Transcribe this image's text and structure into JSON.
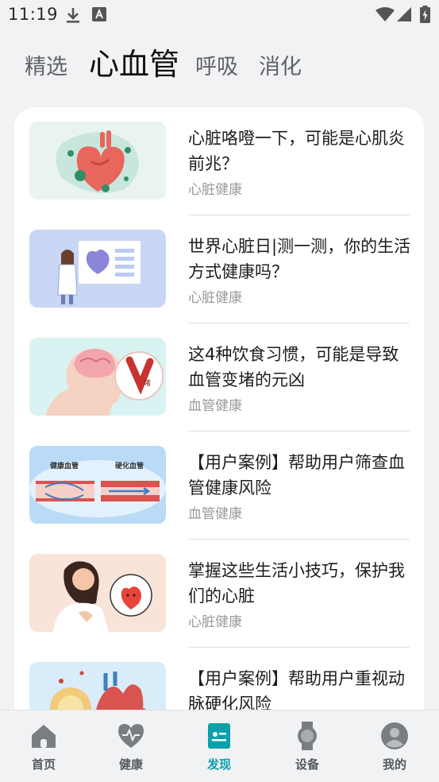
{
  "status_bar": {
    "time": "11:19",
    "icons": [
      "download-icon",
      "keyboard-a-icon",
      "wifi-icon",
      "signal-icon",
      "battery-charging-icon"
    ]
  },
  "tabs": [
    {
      "label": "精选",
      "active": false
    },
    {
      "label": "心血管",
      "active": true
    },
    {
      "label": "呼吸",
      "active": false
    },
    {
      "label": "消化",
      "active": false
    }
  ],
  "articles": [
    {
      "title": "心脏咯噔一下，可能是心肌炎前兆？",
      "tag": "心脏健康",
      "image": "heart-virus-illustration"
    },
    {
      "title": "世界心脏日|测一测，你的生活方式健康吗？",
      "tag": "心脏健康",
      "image": "doctor-heart-screen-illustration"
    },
    {
      "title": "这4种饮食习惯，可能是导致血管变堵的元凶",
      "tag": "血管健康",
      "image": "brain-artery-blockage-illustration",
      "image_text": "堵"
    },
    {
      "title": "【用户案例】帮助用户筛查血管健康风险",
      "tag": "血管健康",
      "image": "vessel-comparison-illustration",
      "image_labels": [
        "健康血管",
        "硬化血管"
      ]
    },
    {
      "title": "掌握这些生活小技巧，保护我们的心脏",
      "tag": "心脏健康",
      "image": "woman-heart-illustration"
    },
    {
      "title": "【用户案例】帮助用户重视动脉硬化风险",
      "tag": "",
      "image": "artery-organs-illustration"
    }
  ],
  "bottom_nav": [
    {
      "label": "首页",
      "icon": "home-icon",
      "active": false
    },
    {
      "label": "健康",
      "icon": "heart-pulse-icon",
      "active": false
    },
    {
      "label": "发现",
      "icon": "discover-card-icon",
      "active": true
    },
    {
      "label": "设备",
      "icon": "watch-icon",
      "active": false
    },
    {
      "label": "我的",
      "icon": "profile-icon",
      "active": false
    }
  ],
  "colors": {
    "accent": "#0aa1ad",
    "background": "#f1f2f4",
    "card": "#ffffff",
    "tag_text": "#9a9a9a"
  }
}
